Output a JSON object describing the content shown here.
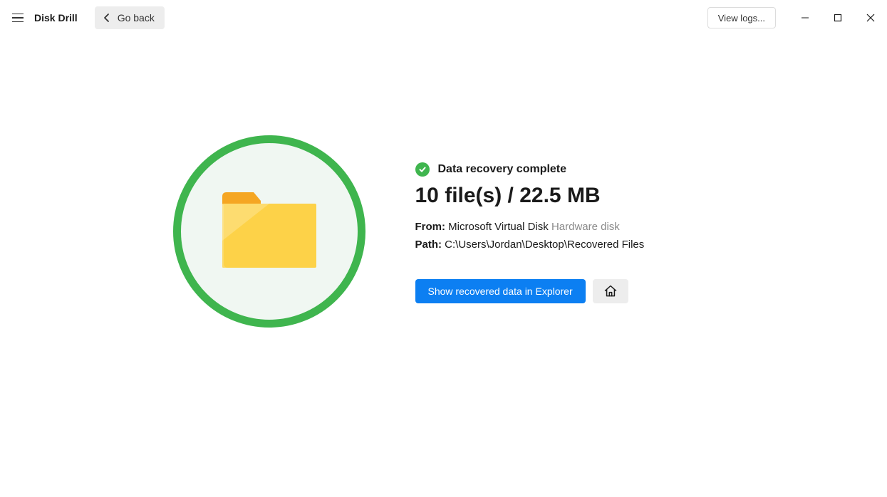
{
  "header": {
    "app_title": "Disk Drill",
    "go_back_label": "Go back",
    "view_logs_label": "View logs..."
  },
  "result": {
    "status_text": "Data recovery complete",
    "big_stat": "10 file(s) / 22.5 MB",
    "from_label": "From:",
    "from_value": "Microsoft Virtual Disk",
    "from_type": "Hardware disk",
    "path_label": "Path:",
    "path_value": "C:\\Users\\Jordan\\Desktop\\Recovered Files",
    "show_in_explorer_label": "Show recovered data in Explorer"
  },
  "colors": {
    "accent_green": "#3fb54e",
    "primary_blue": "#0c7ff2"
  }
}
